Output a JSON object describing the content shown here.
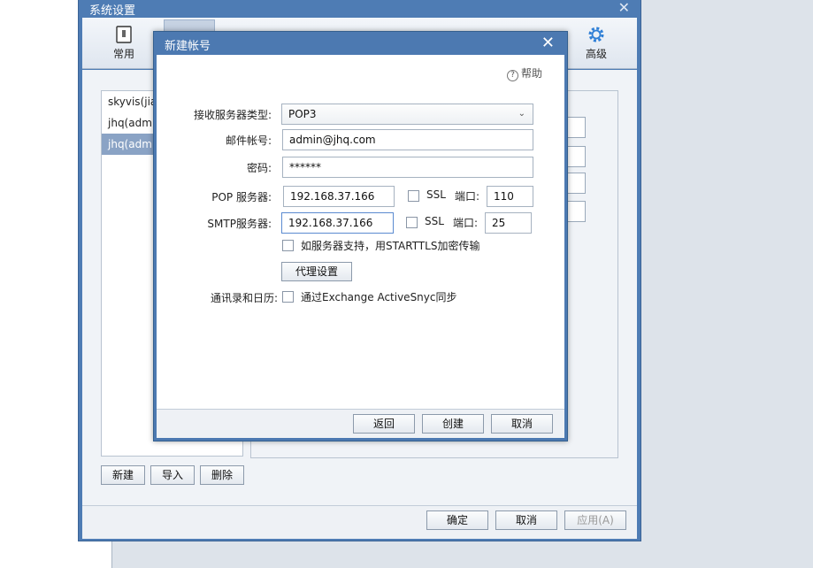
{
  "outer_window": {
    "title": "系统设置",
    "toolbar": {
      "general_label": "常用",
      "advanced_label": "高级"
    },
    "accounts": [
      "skyvis(jia",
      "jhq(admi",
      "jhq(admi"
    ],
    "buttons": {
      "new": "新建",
      "import": "导入",
      "delete": "删除",
      "ok": "确定",
      "cancel": "取消",
      "apply": "应用(A)"
    }
  },
  "dialog": {
    "title": "新建帐号",
    "help": "帮助",
    "labels": {
      "server_type": "接收服务器类型:",
      "account": "邮件帐号:",
      "password": "密码:",
      "pop_server": "POP 服务器:",
      "smtp_server": "SMTP服务器:",
      "ssl": "SSL",
      "port": "端口:",
      "starttls": "如服务器支持，用STARTTLS加密传输",
      "contacts": "通讯录和日历:",
      "activesync": "通过Exchange ActiveSnyc同步"
    },
    "values": {
      "server_type": "POP3",
      "account": "admin@jhq.com",
      "password": "******",
      "pop_server": "192.168.37.166",
      "pop_port": "110",
      "smtp_server": "192.168.37.166",
      "smtp_port": "25"
    },
    "buttons": {
      "proxy": "代理设置",
      "back": "返回",
      "create": "创建",
      "cancel": "取消"
    }
  }
}
